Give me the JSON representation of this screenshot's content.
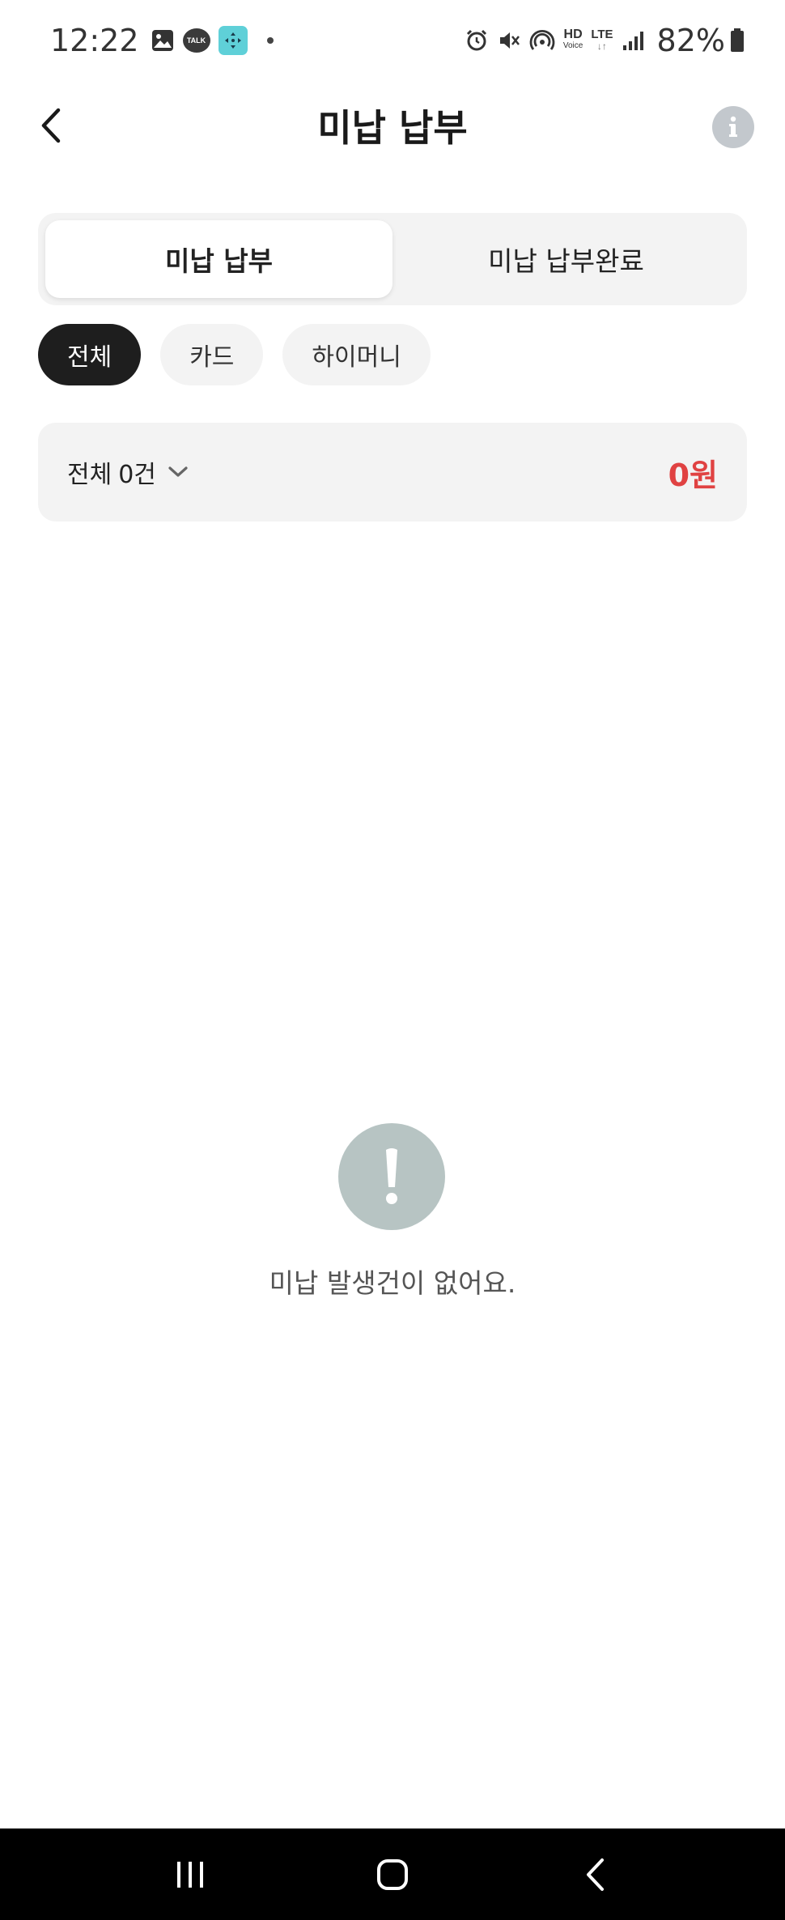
{
  "status_bar": {
    "time": "12:22",
    "talk_label": "TALK",
    "hd_label": "HD",
    "hd_sub": "Voice",
    "lte_label": "LTE",
    "lte_sub": "↓↑",
    "battery": "82%",
    "icons": [
      "image-icon",
      "kakaotalk-icon",
      "app-icon",
      "notification-dot",
      "alarm-icon",
      "mute-icon",
      "hotspot-icon",
      "hd-voice-icon",
      "lte-icon",
      "signal-icon",
      "battery-icon"
    ]
  },
  "header": {
    "title": "미납 납부"
  },
  "tabs": [
    {
      "label": "미납 납부",
      "active": true
    },
    {
      "label": "미납 납부완료",
      "active": false
    }
  ],
  "chips": [
    {
      "label": "전체",
      "active": true
    },
    {
      "label": "카드",
      "active": false
    },
    {
      "label": "하이머니",
      "active": false
    }
  ],
  "summary": {
    "label": "전체",
    "count": "0건",
    "amount": "0원"
  },
  "empty_state": {
    "message": "미납 발생건이 없어요."
  },
  "colors": {
    "accent_red": "#e04242",
    "chip_active": "#1e1e1e",
    "empty_icon_bg": "#b7c4c3",
    "panel_bg": "#f3f3f3"
  }
}
